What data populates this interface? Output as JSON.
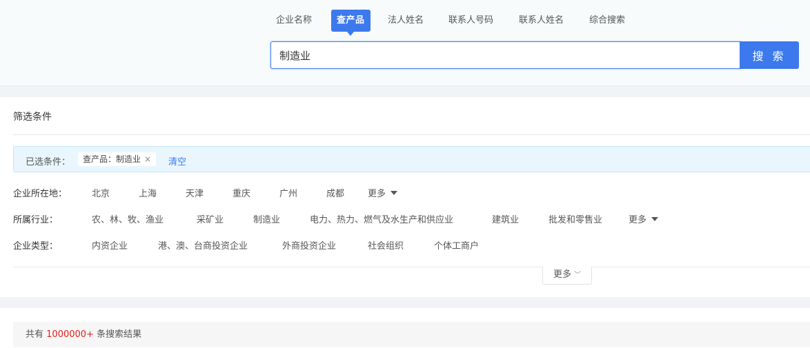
{
  "search": {
    "tabs": [
      {
        "label": "企业名称",
        "active": false
      },
      {
        "label": "查产品",
        "active": true
      },
      {
        "label": "法人姓名",
        "active": false
      },
      {
        "label": "联系人号码",
        "active": false
      },
      {
        "label": "联系人姓名",
        "active": false
      },
      {
        "label": "综合搜索",
        "active": false
      }
    ],
    "query": "制造业",
    "button_label": "搜 索"
  },
  "filters": {
    "title": "筛选条件",
    "selected": {
      "label": "已选条件：",
      "chip": "查产品：制造业",
      "chip_close": "×",
      "clear_label": "清空"
    },
    "location": {
      "label": "企业所在地：",
      "options": [
        "北京",
        "上海",
        "天津",
        "重庆",
        "广州",
        "成都"
      ],
      "more_label": "更多"
    },
    "industry": {
      "label": "所属行业：",
      "options": [
        "农、林、牧、渔业",
        "采矿业",
        "制造业",
        "电力、热力、燃气及水生产和供应业",
        "建筑业",
        "批发和零售业"
      ],
      "more_label": "更多"
    },
    "company_type": {
      "label": "企业类型：",
      "options": [
        "内资企业",
        "港、澳、台商投资企业",
        "外商投资企业",
        "社会组织",
        "个体工商户"
      ]
    },
    "more_toggle_label": "更多",
    "more_toggle_icon": "double-chevron-down-icon"
  },
  "results": {
    "prefix": "共有",
    "count": "1000000+",
    "suffix": "条搜索结果"
  },
  "colors": {
    "accent": "#3c79ec",
    "count_red": "#e0201c",
    "selected_bg": "#e9f6fe"
  }
}
